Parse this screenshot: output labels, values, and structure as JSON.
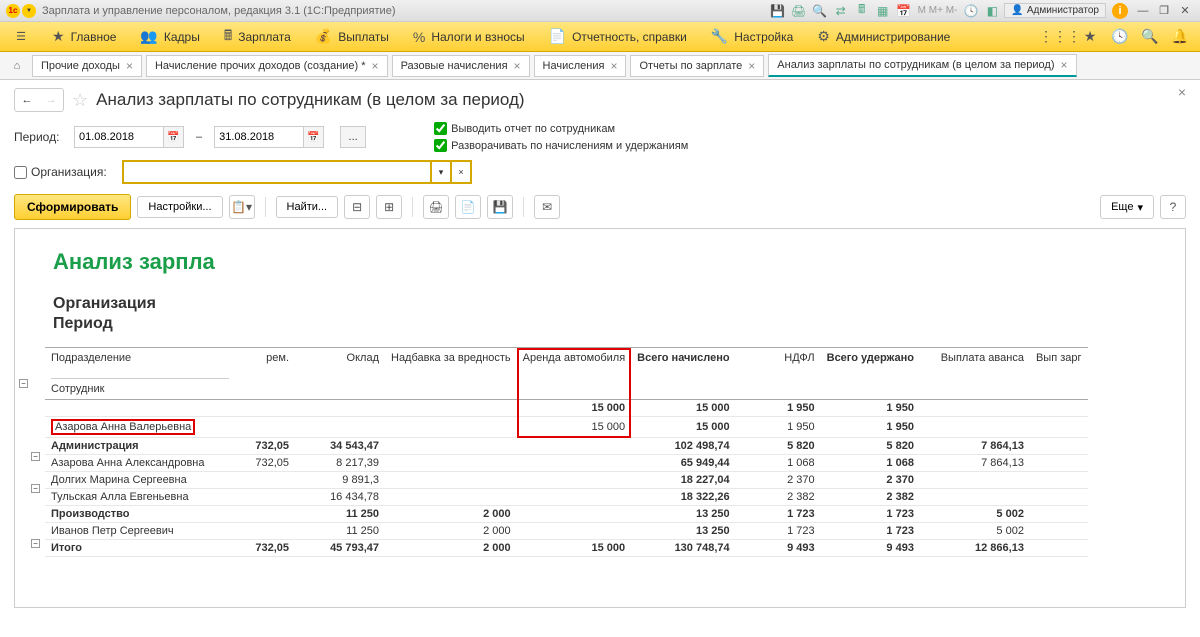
{
  "titlebar": {
    "title": "Зарплата и управление персоналом, редакция 3.1  (1С:Предприятие)",
    "admin": "Администратор"
  },
  "mainmenu": {
    "items": [
      "Главное",
      "Кадры",
      "Зарплата",
      "Выплаты",
      "Налоги и взносы",
      "Отчетность, справки",
      "Настройка",
      "Администрирование"
    ]
  },
  "tabs": [
    {
      "label": "Прочие доходы"
    },
    {
      "label": "Начисление прочих доходов (создание) *"
    },
    {
      "label": "Разовые начисления"
    },
    {
      "label": "Начисления"
    },
    {
      "label": "Отчеты по зарплате"
    },
    {
      "label": "Анализ зарплаты по сотрудникам (в целом за период)",
      "active": true
    }
  ],
  "page": {
    "title": "Анализ зарплаты по сотрудникам (в целом за период)",
    "period_label": "Период:",
    "date_from": "01.08.2018",
    "date_to": "31.08.2018",
    "org_label": "Организация:",
    "org_value": "",
    "chk1": "Выводить отчет по сотрудникам",
    "chk2": "Разворачивать по начислениям и удержаниям",
    "btn_form": "Сформировать",
    "btn_settings": "Настройки...",
    "btn_find": "Найти...",
    "btn_more": "Еще"
  },
  "report": {
    "title": "Анализ зарпла",
    "sub1": "Организация",
    "sub2": "Период",
    "headers": {
      "dept": "Подразделение",
      "emp": "Сотрудник",
      "prem": "рем.",
      "oklad": "Оклад",
      "nadbavka": "Надбавка за вредность",
      "arenda": "Аренда автомобиля",
      "vsego_nach": "Всего начислено",
      "ndfl": "НДФЛ",
      "vsego_uder": "Всего удержано",
      "avans": "Выплата аванса",
      "vypl": "Вып зарг"
    },
    "rows": [
      {
        "type": "group_blank",
        "arenda": "15 000",
        "vsego_nach": "15 000",
        "ndfl": "1 950",
        "vsego_uder": "1 950"
      },
      {
        "type": "emp_hl",
        "name": "Азарова Анна Валерьевна",
        "arenda": "15 000",
        "vsego_nach": "15 000",
        "ndfl": "1 950",
        "vsego_uder": "1 950"
      },
      {
        "type": "group",
        "name": "Администрация",
        "prem": "732,05",
        "oklad": "34 543,47",
        "vsego_nach": "102 498,74",
        "ndfl": "5 820",
        "vsego_uder": "5 820",
        "avans": "7 864,13"
      },
      {
        "type": "emp",
        "name": "Азарова Анна Александровна",
        "prem": "732,05",
        "oklad": "8 217,39",
        "vsego_nach": "65 949,44",
        "ndfl": "1 068",
        "vsego_uder": "1 068",
        "avans": "7 864,13"
      },
      {
        "type": "emp",
        "name": "Долгих Марина Сергеевна",
        "oklad": "9 891,3",
        "vsego_nach": "18 227,04",
        "ndfl": "2 370",
        "vsego_uder": "2 370"
      },
      {
        "type": "emp",
        "name": "Тульская Алла Евгеньевна",
        "oklad": "16 434,78",
        "vsego_nach": "18 322,26",
        "ndfl": "2 382",
        "vsego_uder": "2 382"
      },
      {
        "type": "group",
        "name": "Производство",
        "oklad": "11 250",
        "nadbavka": "2 000",
        "vsego_nach": "13 250",
        "ndfl": "1 723",
        "vsego_uder": "1 723",
        "avans": "5 002"
      },
      {
        "type": "emp",
        "name": "Иванов Петр Сергеевич",
        "oklad": "11 250",
        "nadbavka": "2 000",
        "vsego_nach": "13 250",
        "ndfl": "1 723",
        "vsego_uder": "1 723",
        "avans": "5 002"
      },
      {
        "type": "total",
        "name": "Итого",
        "prem": "732,05",
        "oklad": "45 793,47",
        "nadbavka": "2 000",
        "arenda": "15 000",
        "vsego_nach": "130 748,74",
        "ndfl": "9 493",
        "vsego_uder": "9 493",
        "avans": "12 866,13"
      }
    ]
  }
}
